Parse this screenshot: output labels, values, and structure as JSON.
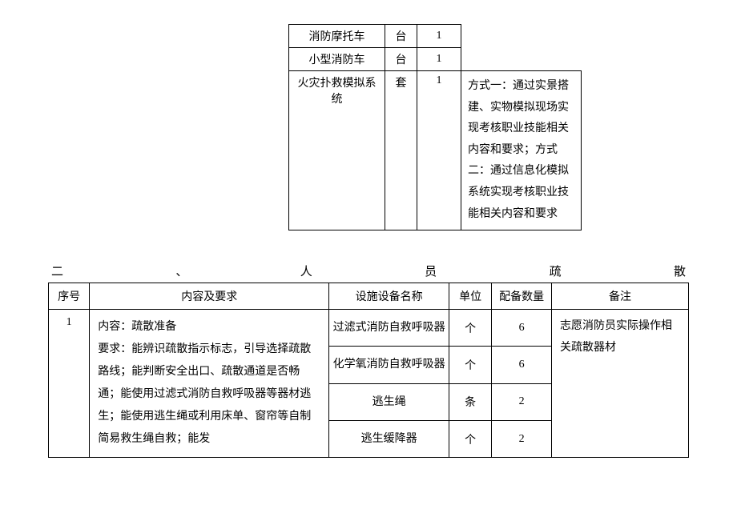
{
  "table1": {
    "rows": [
      {
        "name": "消防摩托车",
        "unit": "台",
        "qty": "1",
        "note": null
      },
      {
        "name": "小型消防车",
        "unit": "台",
        "qty": "1",
        "note": null
      },
      {
        "name": "火灾扑救模拟系统",
        "unit": "套",
        "qty": "1",
        "note": "方式一：通过实景搭建、实物模拟现场实现考核职业技能相关内容和要求；方式二：通过信息化模拟系统实现考核职业技能相关内容和要求"
      }
    ]
  },
  "section2": {
    "heading_chars": [
      "二",
      "、",
      "人",
      "员",
      "疏",
      "散"
    ],
    "headers": {
      "seq": "序号",
      "content": "内容及要求",
      "equip": "设施设备名称",
      "unit": "单位",
      "qty": "配备数量",
      "note": "备注"
    },
    "row": {
      "seq": "1",
      "content": "内容：疏散准备\n要求：能辨识疏散指示标志，引导选择疏散路线；能判断安全出口、疏散通道是否畅通；能使用过滤式消防自救呼吸器等器材逃生；能使用逃生绳或利用床单、窗帘等自制简易救生绳自救；能发",
      "equip_rows": [
        {
          "name": "过滤式消防自救呼吸器",
          "unit": "个",
          "qty": "6"
        },
        {
          "name": "化学氧消防自救呼吸器",
          "unit": "个",
          "qty": "6"
        },
        {
          "name": "逃生绳",
          "unit": "条",
          "qty": "2"
        },
        {
          "name": "逃生缓降器",
          "unit": "个",
          "qty": "2"
        }
      ],
      "note": "志愿消防员实际操作相关疏散器材"
    }
  }
}
